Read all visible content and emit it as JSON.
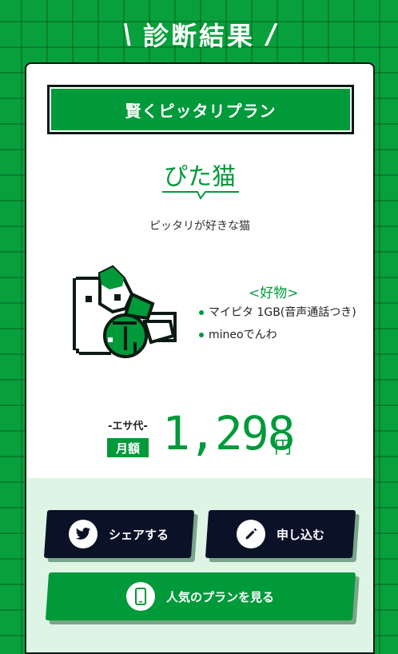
{
  "header": {
    "title": "診断結果",
    "slash_left": "\\",
    "slash_right": "/"
  },
  "result": {
    "plan_name": "賢くピッタリプラン",
    "type_title": "ぴた猫",
    "type_description": "ピッタリが好きな猫",
    "favorites_title": "<好物>",
    "favorites": [
      "マイピタ 1GB(音声通話つき)",
      "mineoでんわ"
    ],
    "price_label": "-エサ代-",
    "monthly_label": "月額",
    "price": "1,298",
    "currency": "円"
  },
  "buttons": {
    "share": "シェアする",
    "apply": "申し込む",
    "popular": "人気のプランを見る"
  },
  "colors": {
    "brand_green": "#009a3a",
    "dark_navy": "#0b1228",
    "light_mint": "#def5e6"
  },
  "icons": {
    "share": "twitter-bird-icon",
    "apply": "pencil-icon",
    "popular": "smartphone-icon",
    "cat": "pixel-cat-icon"
  }
}
